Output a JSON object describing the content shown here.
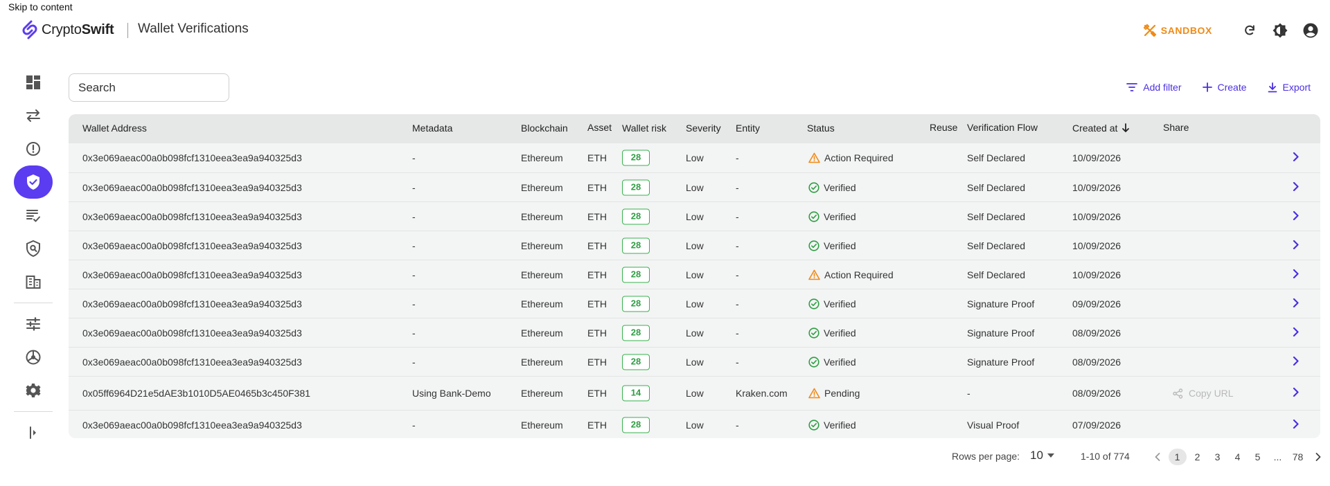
{
  "skip_link": "Skip to content",
  "brand": {
    "name_light": "Crypto",
    "name_bold": "Swift",
    "color": "#5b3cf0"
  },
  "page_title": "Wallet Verifications",
  "header": {
    "sandbox_label": "SANDBOX",
    "sandbox_color": "#f08a16",
    "icons": [
      "refresh-icon",
      "theme-toggle-icon",
      "account-icon"
    ]
  },
  "sidebar": {
    "items": [
      {
        "icon": "dashboard-icon"
      },
      {
        "icon": "transfers-icon"
      },
      {
        "icon": "alerts-icon"
      },
      {
        "icon": "wallet-verification-icon",
        "active": true
      },
      {
        "icon": "reports-icon"
      },
      {
        "icon": "screening-icon"
      },
      {
        "icon": "entities-icon"
      },
      {
        "icon": "rules-icon"
      },
      {
        "icon": "integrations-icon"
      },
      {
        "icon": "settings-icon"
      },
      {
        "icon": "expand-sidebar-icon"
      }
    ]
  },
  "toolbar": {
    "search_placeholder": "Search",
    "add_filter": "Add filter",
    "create": "Create",
    "export": "Export",
    "accent": "#4a2fe0"
  },
  "table": {
    "columns": [
      "Wallet Address",
      "Metadata",
      "Blockchain",
      "Asset",
      "Wallet risk",
      "Severity",
      "Entity",
      "Status",
      "Reuse",
      "Verification Flow",
      "Created at",
      "Share"
    ],
    "rows": [
      {
        "address": "0x3e069aeac00a0b098fcf1310eea3ea9a940325d3",
        "metadata": "-",
        "blockchain": "Ethereum",
        "asset": "ETH",
        "risk": "28",
        "severity": "Low",
        "entity": "-",
        "status": "Action Required",
        "status_type": "warning",
        "reuse": "",
        "flow": "Self Declared",
        "created": "10/09/2026",
        "share": ""
      },
      {
        "address": "0x3e069aeac00a0b098fcf1310eea3ea9a940325d3",
        "metadata": "-",
        "blockchain": "Ethereum",
        "asset": "ETH",
        "risk": "28",
        "severity": "Low",
        "entity": "-",
        "status": "Verified",
        "status_type": "verified",
        "reuse": "",
        "flow": "Self Declared",
        "created": "10/09/2026",
        "share": ""
      },
      {
        "address": "0x3e069aeac00a0b098fcf1310eea3ea9a940325d3",
        "metadata": "-",
        "blockchain": "Ethereum",
        "asset": "ETH",
        "risk": "28",
        "severity": "Low",
        "entity": "-",
        "status": "Verified",
        "status_type": "verified",
        "reuse": "",
        "flow": "Self Declared",
        "created": "10/09/2026",
        "share": ""
      },
      {
        "address": "0x3e069aeac00a0b098fcf1310eea3ea9a940325d3",
        "metadata": "-",
        "blockchain": "Ethereum",
        "asset": "ETH",
        "risk": "28",
        "severity": "Low",
        "entity": "-",
        "status": "Verified",
        "status_type": "verified",
        "reuse": "",
        "flow": "Self Declared",
        "created": "10/09/2026",
        "share": ""
      },
      {
        "address": "0x3e069aeac00a0b098fcf1310eea3ea9a940325d3",
        "metadata": "-",
        "blockchain": "Ethereum",
        "asset": "ETH",
        "risk": "28",
        "severity": "Low",
        "entity": "-",
        "status": "Action Required",
        "status_type": "warning",
        "reuse": "",
        "flow": "Self Declared",
        "created": "10/09/2026",
        "share": ""
      },
      {
        "address": "0x3e069aeac00a0b098fcf1310eea3ea9a940325d3",
        "metadata": "-",
        "blockchain": "Ethereum",
        "asset": "ETH",
        "risk": "28",
        "severity": "Low",
        "entity": "-",
        "status": "Verified",
        "status_type": "verified",
        "reuse": "",
        "flow": "Signature Proof",
        "created": "09/09/2026",
        "share": ""
      },
      {
        "address": "0x3e069aeac00a0b098fcf1310eea3ea9a940325d3",
        "metadata": "-",
        "blockchain": "Ethereum",
        "asset": "ETH",
        "risk": "28",
        "severity": "Low",
        "entity": "-",
        "status": "Verified",
        "status_type": "verified",
        "reuse": "",
        "flow": "Signature Proof",
        "created": "08/09/2026",
        "share": ""
      },
      {
        "address": "0x3e069aeac00a0b098fcf1310eea3ea9a940325d3",
        "metadata": "-",
        "blockchain": "Ethereum",
        "asset": "ETH",
        "risk": "28",
        "severity": "Low",
        "entity": "-",
        "status": "Verified",
        "status_type": "verified",
        "reuse": "",
        "flow": "Signature Proof",
        "created": "08/09/2026",
        "share": ""
      },
      {
        "address": "0x05ff6964D21e5dAE3b1010D5AE0465b3c450F381",
        "metadata": "Using Bank-Demo",
        "blockchain": "Ethereum",
        "asset": "ETH",
        "risk": "14",
        "severity": "Low",
        "entity": "Kraken.com",
        "status": "Pending",
        "status_type": "warning",
        "reuse": "",
        "flow": "-",
        "created": "08/09/2026",
        "share": "Copy URL"
      },
      {
        "address": "0x3e069aeac00a0b098fcf1310eea3ea9a940325d3",
        "metadata": "-",
        "blockchain": "Ethereum",
        "asset": "ETH",
        "risk": "28",
        "severity": "Low",
        "entity": "-",
        "status": "Verified",
        "status_type": "verified",
        "reuse": "",
        "flow": "Visual Proof",
        "created": "07/09/2026",
        "share": ""
      }
    ],
    "colors": {
      "risk_low": "#37b24d",
      "verified": "#2f9e44",
      "warning": "#f08a16"
    }
  },
  "pagination": {
    "rows_per_page_label": "Rows per page:",
    "rows_per_page": "10",
    "range": "1-10 of 774",
    "pages": [
      "1",
      "2",
      "3",
      "4",
      "5",
      "...",
      "78"
    ],
    "current": "1"
  }
}
